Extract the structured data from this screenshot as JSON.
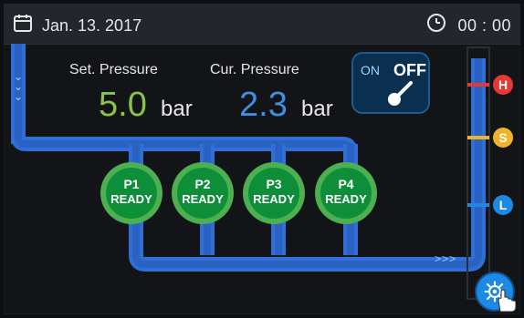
{
  "status_bar": {
    "date": "Jan. 13. 2017",
    "time": "00 : 00"
  },
  "pressure": {
    "set_label": "Set. Pressure",
    "set_value": "5.0",
    "set_unit": "bar",
    "cur_label": "Cur. Pressure",
    "cur_value": "2.3",
    "cur_unit": "bar"
  },
  "power_toggle": {
    "on_label": "ON",
    "off_label": "OFF",
    "state": "OFF"
  },
  "pumps": [
    {
      "name": "P1",
      "status": "READY"
    },
    {
      "name": "P2",
      "status": "READY"
    },
    {
      "name": "P3",
      "status": "READY"
    },
    {
      "name": "P4",
      "status": "READY"
    }
  ],
  "level_sensors": [
    {
      "label": "H",
      "color": "#e53935"
    },
    {
      "label": "S",
      "color": "#f0b429"
    },
    {
      "label": "L",
      "color": "#1e88e5"
    }
  ],
  "pipe_flow_glyph": ">>>",
  "colors": {
    "accent_blue": "#1e88e5",
    "pipe_blue": "#2f6fd6",
    "ready_green": "#4caf50",
    "set_green": "#8bc34a",
    "cur_blue": "#3f8fe0"
  },
  "icons": {
    "calendar": "calendar-icon",
    "clock": "clock-icon",
    "settings": "gear-icon",
    "touch": "hand-pointer-icon"
  }
}
